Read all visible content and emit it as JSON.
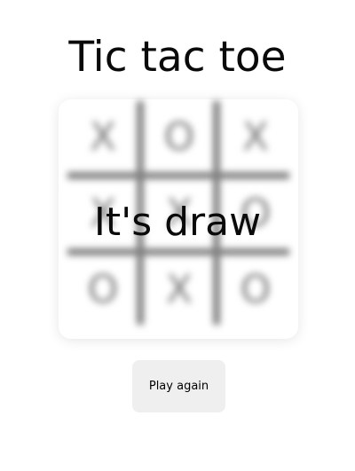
{
  "title": "Tic tac toe",
  "board": {
    "cells": [
      [
        "X",
        "O",
        "X"
      ],
      [
        "X",
        "X",
        "O"
      ],
      [
        "O",
        "X",
        "O"
      ]
    ]
  },
  "status": "It's draw",
  "play_again_label": "Play again",
  "colors": {
    "background": "#ffffff",
    "text": "#0a0a0a",
    "grid": "#7e7e7e",
    "mark": "#7a7a7a",
    "button": "#efefef"
  }
}
